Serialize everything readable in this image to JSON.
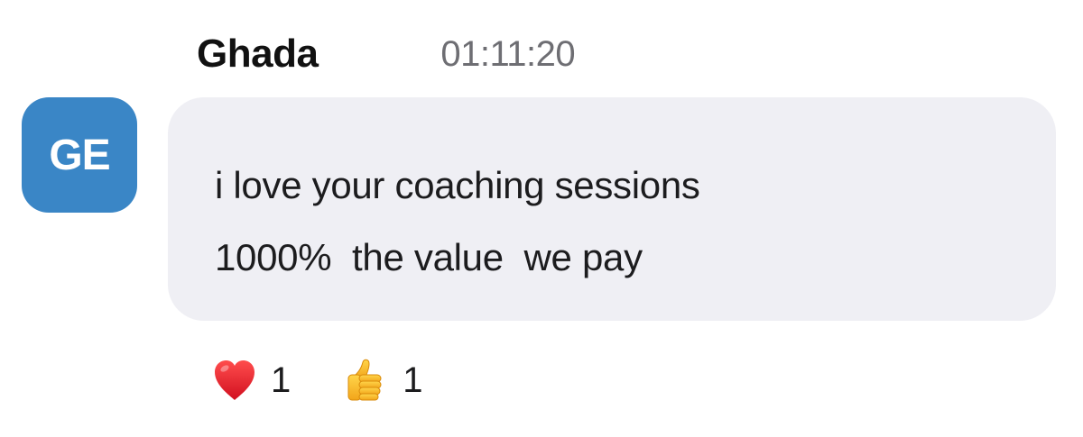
{
  "message": {
    "author": "Ghada",
    "timestamp": "01:11:20",
    "avatar": {
      "initials": "GE",
      "color": "#3a86c6"
    },
    "bubble_color": "#efeff4",
    "text_lines": [
      "i love your coaching sessions",
      "1000%  the value  we pay"
    ]
  },
  "reactions": [
    {
      "icon": "red-heart-icon",
      "count": "1"
    },
    {
      "icon": "thumbs-up-icon",
      "count": "1"
    }
  ]
}
